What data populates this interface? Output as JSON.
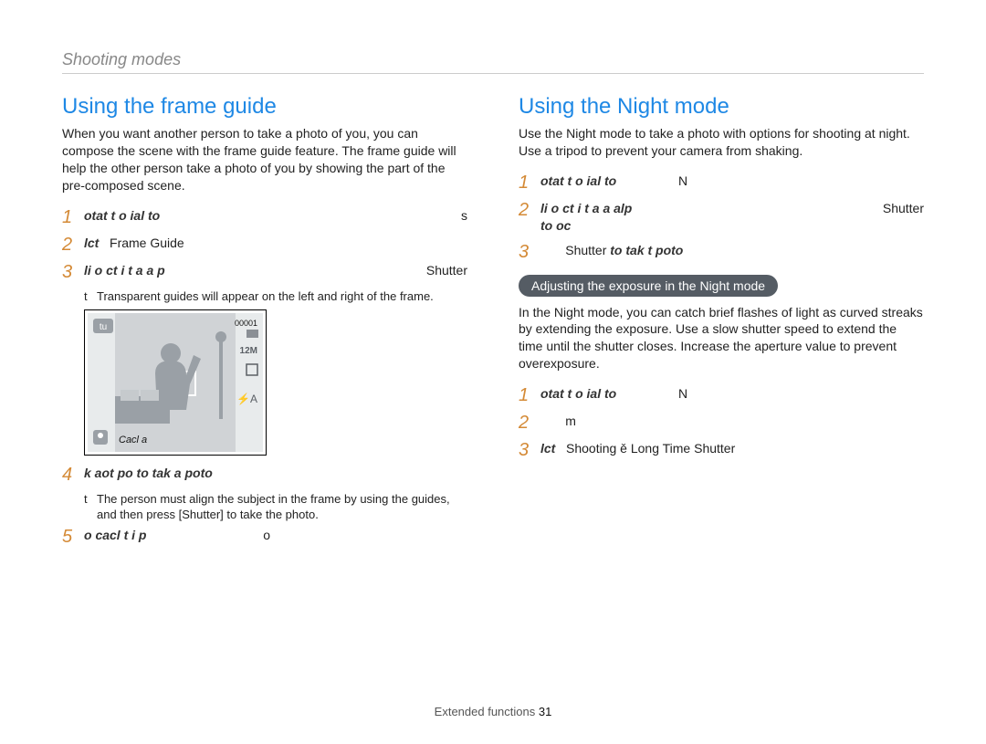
{
  "breadcrumb": "Shooting modes",
  "left": {
    "title": "Using the frame guide",
    "intro": "When you want another person to take a photo of you, you can compose the scene with the frame guide feature. The frame guide will help the other person take a photo of you by showing the part of the pre-composed scene.",
    "steps": [
      {
        "n": "1",
        "em": "otat t o  ial to",
        "tail": "s"
      },
      {
        "n": "2",
        "em": "lct",
        "tail": "Frame Guide"
      },
      {
        "n": "3",
        "em": "li o ct i t a  a p",
        "tail": "Shutter"
      }
    ],
    "bullet1": "Transparent guides will appear on the left and right of the frame.",
    "figure": {
      "counter": "00001",
      "res": "12M",
      "label": "Cacl a",
      "flash": "⚡A",
      "square": "□"
    },
    "step4": {
      "n": "4",
      "em": "k aot po to tak a poto"
    },
    "bullet2": "The person must align the subject in the frame by using the guides, and then press [Shutter] to take the photo.",
    "step5": {
      "n": "5",
      "em": "o cacl t i p",
      "tail": "o"
    }
  },
  "right": {
    "title": "Using the Night mode",
    "intro": "Use the Night mode to take a photo with options for shooting at night. Use a tripod to prevent your camera from shaking.",
    "steps_a": [
      {
        "n": "1",
        "em": "otat t o  ial to",
        "tail": "N"
      },
      {
        "n": "2",
        "em": "li o ct i t a  a alp",
        "em2": "to oc",
        "tail": "Shutter"
      },
      {
        "n": "3",
        "lead": "Shutter",
        "em": " to tak t poto"
      }
    ],
    "pill": "Adjusting the exposure in the Night mode",
    "subintro": "In the Night mode, you can catch brief ﬂashes of light as curved streaks by extending the exposure. Use a slow shutter speed to extend the time until the shutter closes. Increase the aperture value to prevent overexposure.",
    "steps_b": [
      {
        "n": "1",
        "em": "otat t o  ial to",
        "tail": "N"
      },
      {
        "n": "2",
        "tail": "m"
      },
      {
        "n": "3",
        "em": "lct",
        "tail": "Shooting ě  Long Time Shutter"
      }
    ]
  },
  "footer": {
    "label": "Extended functions",
    "page": "31"
  }
}
